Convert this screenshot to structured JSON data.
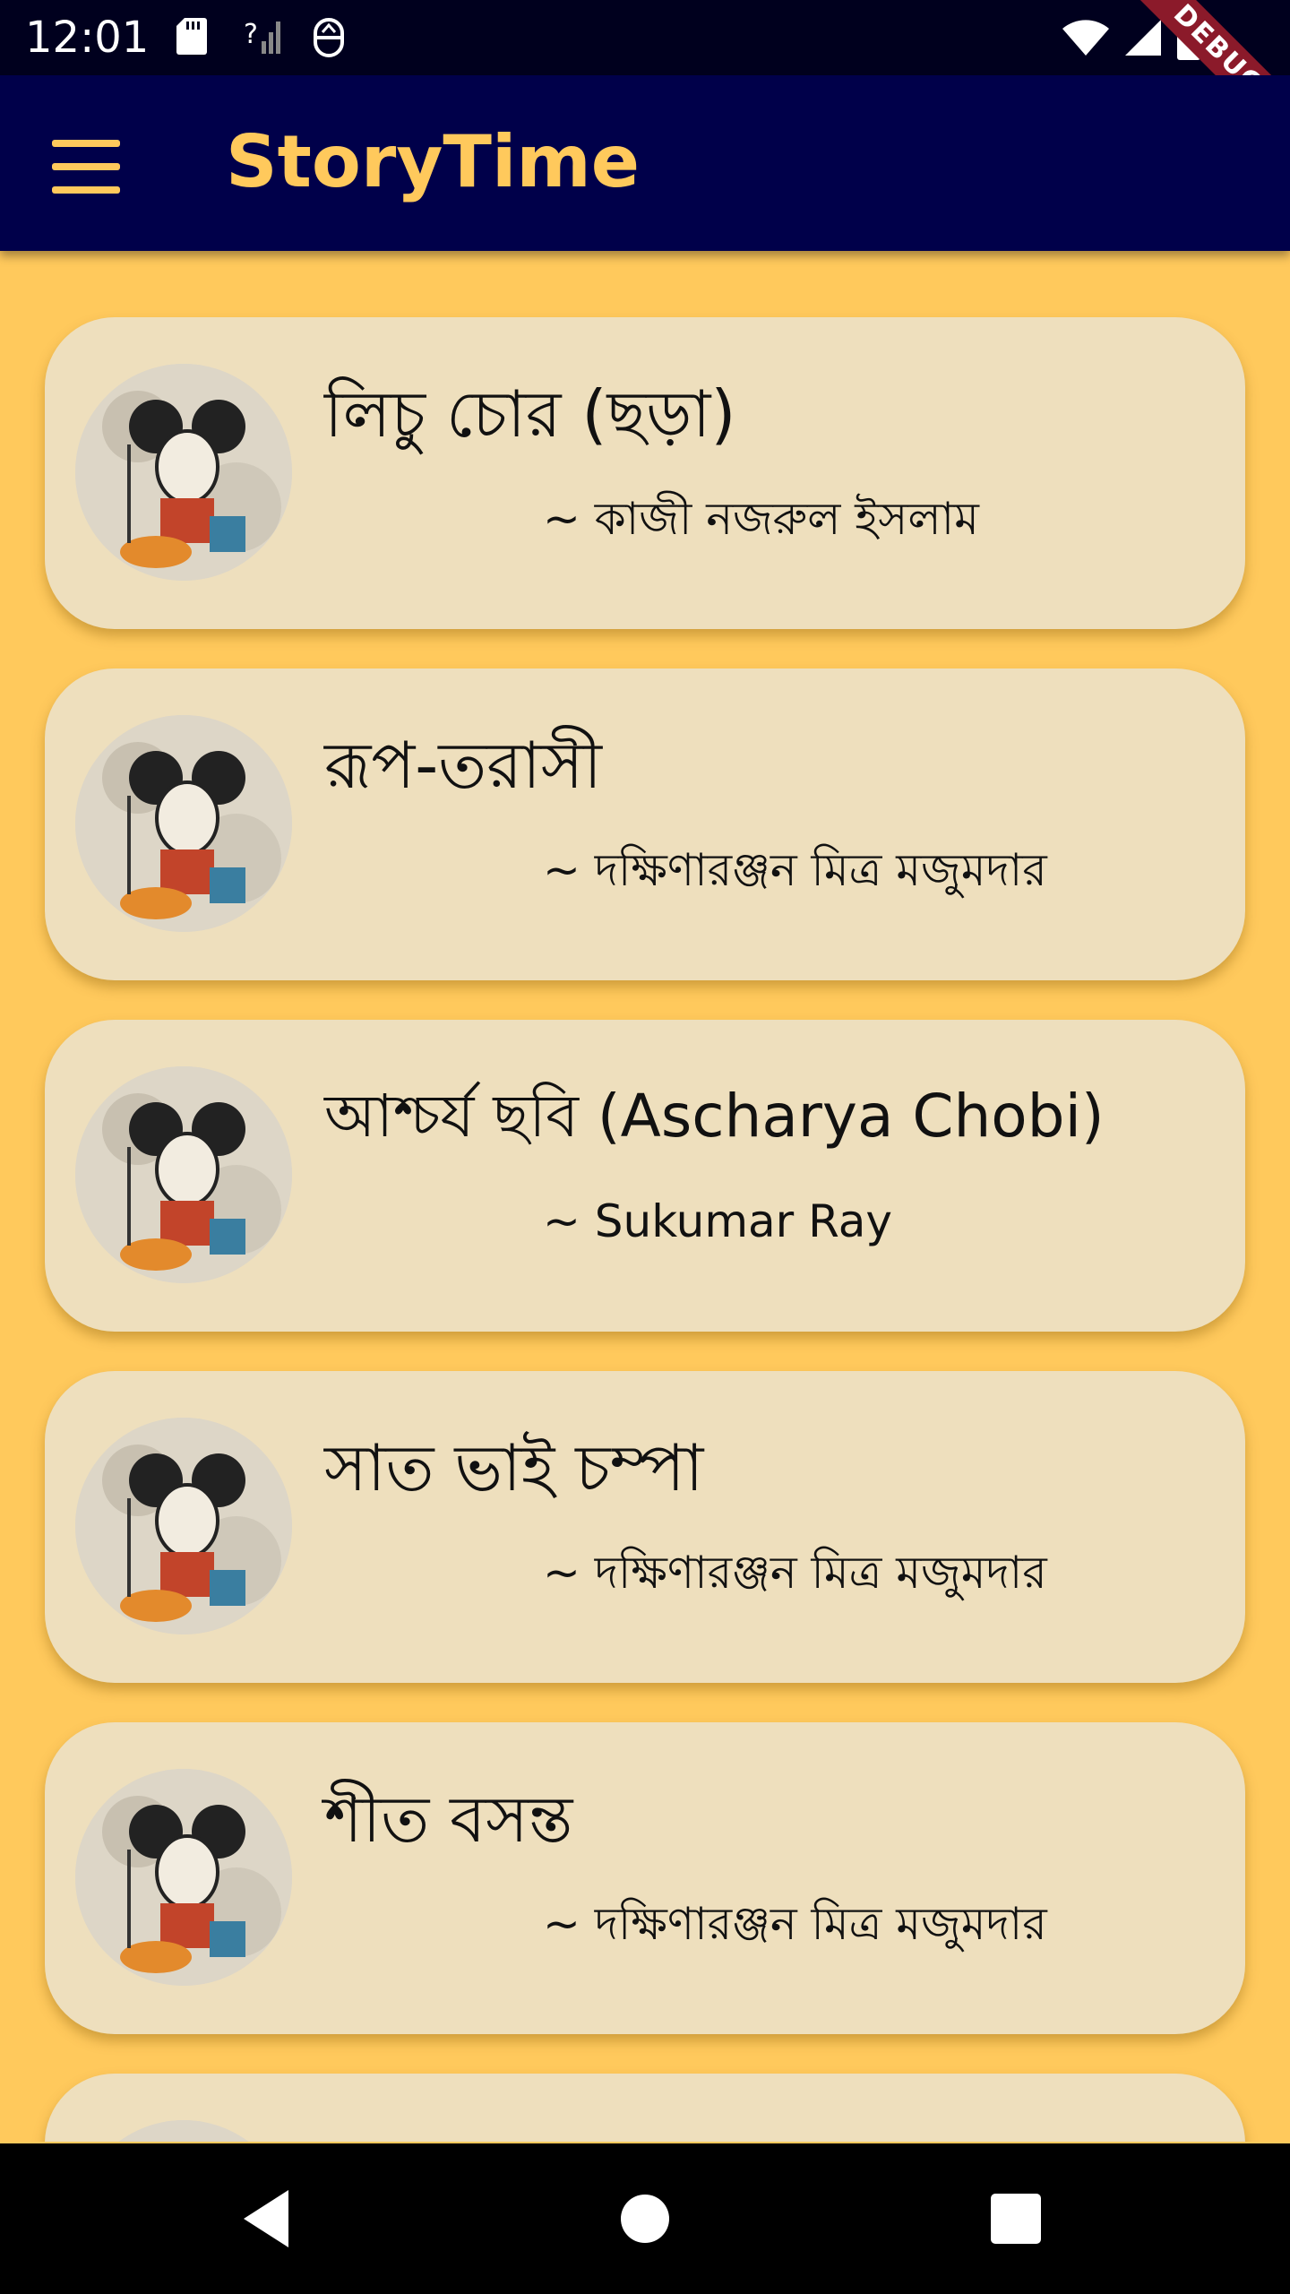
{
  "status_bar": {
    "time": "12:01",
    "icons_left": [
      "sd-card-icon",
      "no-signal-icon",
      "vpn-icon"
    ],
    "icons_right": [
      "wifi-icon",
      "cell-signal-icon",
      "battery-icon"
    ],
    "debug_label": "DEBUG"
  },
  "app_bar": {
    "title": "StoryTime",
    "menu_icon": "hamburger-menu-icon",
    "title_color": "#FFC95C",
    "background": "#00004A"
  },
  "colors": {
    "page_background": "#FFC95C",
    "card_background": "#EEDFBD",
    "status_bar": "#00001E",
    "debug_banner": "#8B1A2A"
  },
  "stories": [
    {
      "title": "লিচু চোর (ছড়া)",
      "author": "~ কাজী নজরুল ইসলাম"
    },
    {
      "title": "রূপ-তরাসী",
      "author": "~ দক্ষিণারঞ্জন মিত্র মজুমদার"
    },
    {
      "title": "আশ্চর্য ছবি (Ascharya Chobi)",
      "author": "~ Sukumar Ray"
    },
    {
      "title": "সাত ভাই চম্পা",
      "author": "~ দক্ষিণারঞ্জন মিত্র মজুমদার"
    },
    {
      "title": "শীত বসন্ত",
      "author": "~ দক্ষিণারঞ্জন মিত্র মজুমদার"
    },
    {
      "title": "",
      "author": ""
    }
  ],
  "nav_bar": {
    "buttons": [
      "back-icon",
      "home-icon",
      "recents-icon"
    ]
  }
}
